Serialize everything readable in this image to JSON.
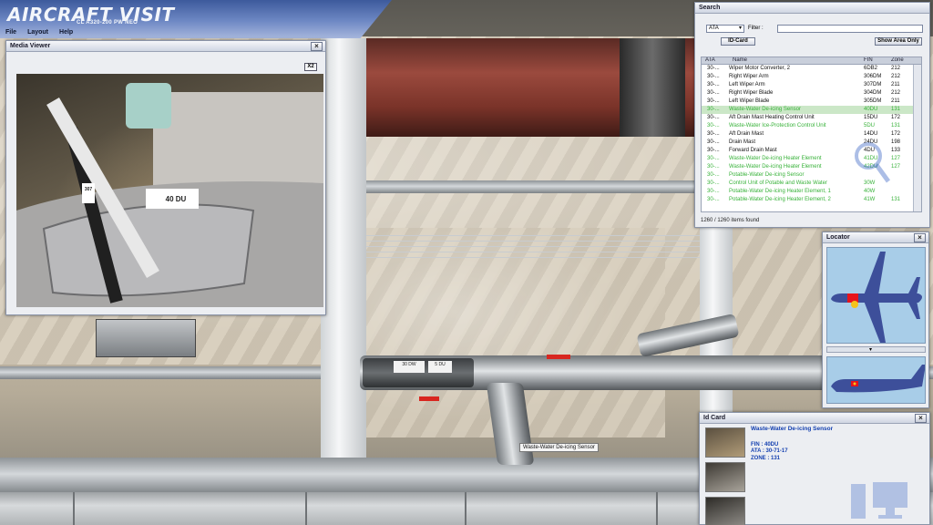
{
  "app": {
    "title": "AIRCRAFT VISIT",
    "subtitle": "CL A320-200 PW NEO",
    "menu": [
      "File",
      "Layout",
      "Help"
    ]
  },
  "media_viewer": {
    "title": "Media Viewer",
    "close_label": "×",
    "zoom_label": "X2",
    "photo_tags": [
      "40 DU",
      "307"
    ]
  },
  "search": {
    "title": "Search",
    "type_value": "ATA",
    "filter_label": "Filter :",
    "filter_value": "",
    "idcard_button": "ID-Card",
    "show_area_button": "Show Area Only",
    "columns": [
      "ATA",
      "Name",
      "FIN",
      "Zone"
    ],
    "rows": [
      {
        "ata": "30-...",
        "name": "Wiper Motor Converter, 2",
        "fin": "6DB2",
        "zone": "212",
        "style": "black"
      },
      {
        "ata": "30-...",
        "name": "Right Wiper Arm",
        "fin": "306DM",
        "zone": "212",
        "style": "black"
      },
      {
        "ata": "30-...",
        "name": "Left Wiper Arm",
        "fin": "307DM",
        "zone": "211",
        "style": "black"
      },
      {
        "ata": "30-...",
        "name": "Right Wiper Blade",
        "fin": "304DM",
        "zone": "212",
        "style": "black"
      },
      {
        "ata": "30-...",
        "name": "Left Wiper Blade",
        "fin": "305DM",
        "zone": "211",
        "style": "black"
      },
      {
        "ata": "30-...",
        "name": "Waste-Water De-icing Sensor",
        "fin": "40DU",
        "zone": "131",
        "style": "sel"
      },
      {
        "ata": "30-...",
        "name": "Aft Drain Mast Heating Control Unit",
        "fin": "15DU",
        "zone": "172",
        "style": "black"
      },
      {
        "ata": "30-...",
        "name": "Waste-Water Ice-Protection Control Unit",
        "fin": "5DU",
        "zone": "131",
        "style": "green"
      },
      {
        "ata": "30-...",
        "name": "Aft Drain Mast",
        "fin": "14DU",
        "zone": "172",
        "style": "black"
      },
      {
        "ata": "30-...",
        "name": "Drain Mast",
        "fin": "24DU",
        "zone": "198",
        "style": "black"
      },
      {
        "ata": "30-...",
        "name": "Forward Drain Mast",
        "fin": "4DU",
        "zone": "133",
        "style": "black"
      },
      {
        "ata": "30-...",
        "name": "Waste-Water De-icing Heater Element",
        "fin": "41DU",
        "zone": "127",
        "style": "green"
      },
      {
        "ata": "30-...",
        "name": "Waste-Water De-icing Heater Element",
        "fin": "42DU",
        "zone": "127",
        "style": "green"
      },
      {
        "ata": "30-...",
        "name": "Potable-Water De-icing Sensor",
        "fin": "",
        "zone": "",
        "style": "green"
      },
      {
        "ata": "30-...",
        "name": "Control Unit of Potable and Waste Water",
        "fin": "30W",
        "zone": "",
        "style": "green"
      },
      {
        "ata": "30-...",
        "name": "Potable-Water De-icing Heater Element, 1",
        "fin": "40W",
        "zone": "",
        "style": "green"
      },
      {
        "ata": "30-...",
        "name": "Potable-Water De-icing Heater Element, 2",
        "fin": "41W",
        "zone": "131",
        "style": "green"
      }
    ],
    "items_found": "1260 / 1260 items found"
  },
  "locator": {
    "title": "Locator",
    "close_label": "×"
  },
  "idcard": {
    "title": "Id Card",
    "close_label": "×",
    "name": "Waste-Water De-icing Sensor",
    "fin": "FIN : 40DU",
    "ata": "ATA : 30-71-17",
    "zone": "ZONE : 131"
  },
  "scene": {
    "tooltip": "Waste-Water De-icing Sensor",
    "sensor_tags": [
      "30 DW",
      "5 DU"
    ]
  },
  "colors": {
    "list_green": "#38b23a",
    "idcard_blue": "#1440b0",
    "locator_sky": "#a8cde8",
    "aircraft_blue": "#3d4f9a",
    "highlight_red": "#e8141a",
    "highlight_yellow": "#f4c21a"
  }
}
